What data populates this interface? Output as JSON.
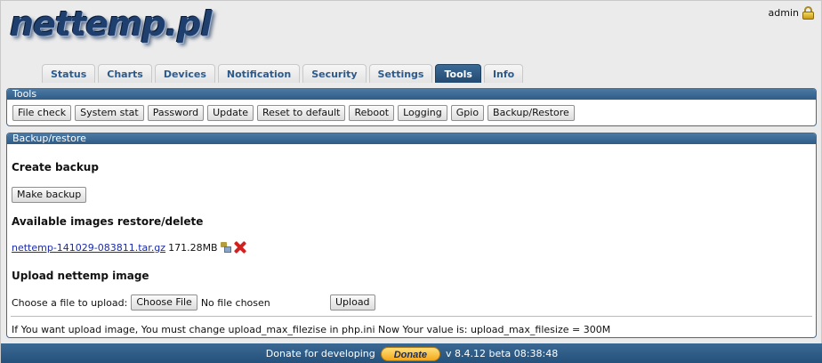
{
  "header": {
    "logo": "nettemp.pl",
    "user": "admin",
    "user_icon": "lock-icon"
  },
  "tabs": [
    {
      "label": "Status",
      "active": false
    },
    {
      "label": "Charts",
      "active": false
    },
    {
      "label": "Devices",
      "active": false
    },
    {
      "label": "Notification",
      "active": false
    },
    {
      "label": "Security",
      "active": false
    },
    {
      "label": "Settings",
      "active": false
    },
    {
      "label": "Tools",
      "active": true
    },
    {
      "label": "Info",
      "active": false
    }
  ],
  "tools_panel": {
    "title": "Tools",
    "buttons": [
      "File check",
      "System stat",
      "Password",
      "Update",
      "Reset to default",
      "Reboot",
      "Logging",
      "Gpio",
      "Backup/Restore"
    ]
  },
  "backup_panel": {
    "title": "Backup/restore",
    "create_title": "Create backup",
    "make_backup_label": "Make backup",
    "available_title": "Available images restore/delete",
    "images": [
      {
        "file": "nettemp-141029-083811.tar.gz",
        "size": "171.28MB",
        "restore_icon": "restore-icon",
        "delete_icon": "delete-icon"
      }
    ],
    "upload_title": "Upload nettemp image",
    "choose_label": "Choose a file to upload:",
    "choose_button": "Choose File",
    "no_file": "No file chosen",
    "upload_button": "Upload",
    "note": "If You want upload image, You must change upload_max_filezise in php.ini Now Your value is: upload_max_filesize = 300M"
  },
  "footer": {
    "donate_text": "Donate for developing",
    "donate_button": "Donate",
    "version": "v 8.4.12 beta 08:38:48"
  },
  "colors": {
    "accent": "#2f5c87",
    "tab_text": "#2d5a8c",
    "donate": "#f4a81c",
    "delete": "#d32020",
    "link": "#1a2aa8"
  }
}
